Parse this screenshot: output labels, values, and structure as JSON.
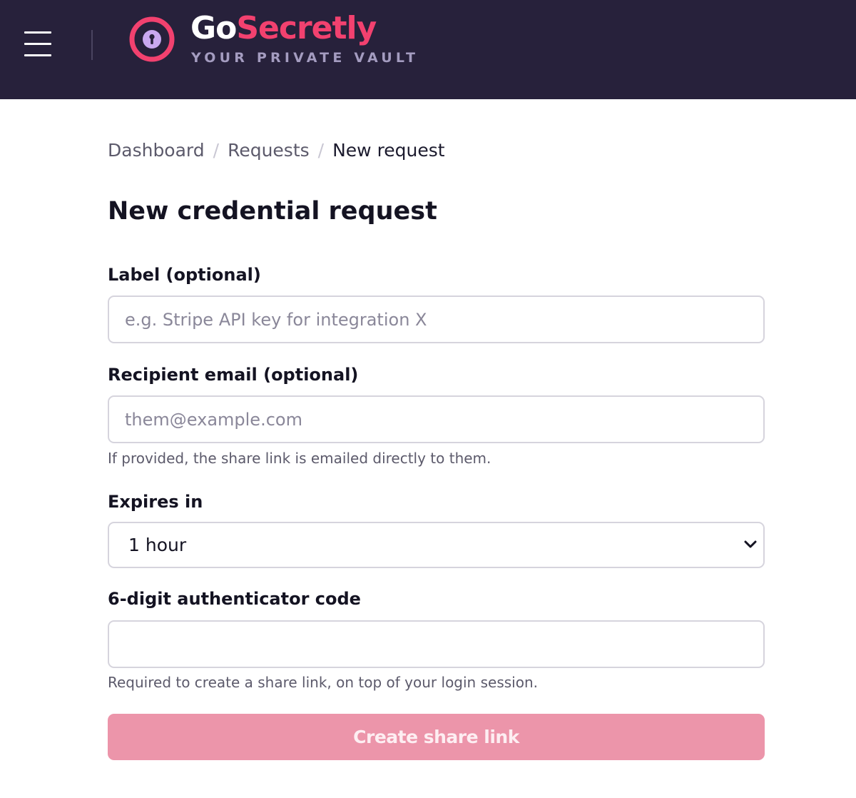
{
  "header": {
    "brand_go": "Go",
    "brand_secretly": "Secretly",
    "tagline": "YOUR PRIVATE VAULT",
    "menu_icon": "hamburger-menu-icon",
    "logo_icon": "keyhole-icon",
    "colors": {
      "background": "#27213b",
      "accent": "#f2416f",
      "logo_fill": "#c9a8f0"
    }
  },
  "breadcrumb": {
    "items": [
      "Dashboard",
      "Requests"
    ],
    "separator": "/",
    "current": "New request"
  },
  "page": {
    "title": "New credential request"
  },
  "form": {
    "label_field": {
      "label": "Label (optional)",
      "placeholder": "e.g. Stripe API key for integration X",
      "value": ""
    },
    "email_field": {
      "label": "Recipient email (optional)",
      "placeholder": "them@example.com",
      "value": "",
      "hint": "If provided, the share link is emailed directly to them."
    },
    "expires_field": {
      "label": "Expires in",
      "selected": "1 hour",
      "icon": "chevron-down-icon"
    },
    "code_field": {
      "label": "6-digit authenticator code",
      "value": "",
      "hint": "Required to create a share link, on top of your login session."
    },
    "submit": {
      "label": "Create share link",
      "state": "disabled",
      "color": "#ec95aa"
    }
  }
}
